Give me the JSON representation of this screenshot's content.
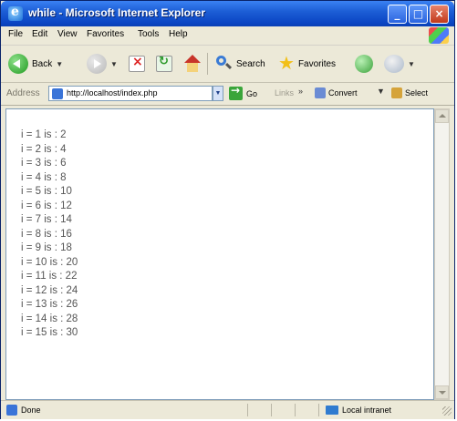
{
  "window": {
    "title": "while - Microsoft Internet Explorer",
    "controls": {
      "minimize": "_",
      "maximize": "□",
      "close": "×"
    }
  },
  "menu": {
    "items": [
      "File",
      "Edit",
      "View",
      "Favorites",
      "Tools",
      "Help"
    ]
  },
  "toolbar": {
    "back_label": "Back",
    "search_label": "Search",
    "favorites_label": "Favorites",
    "icons": [
      "back-icon",
      "forward-icon",
      "stop-icon",
      "refresh-icon",
      "home-icon",
      "search-icon",
      "favorites-icon",
      "media-icon",
      "mail-icon"
    ]
  },
  "address_bar": {
    "label": "Address",
    "url": "http://localhost/index.php",
    "go_label": "Go",
    "links_label": "Links",
    "convert_label": "Convert",
    "select_label": "Select"
  },
  "content": {
    "lines": [
      "i = 1 is : 2",
      "i = 2 is : 4",
      "i = 3 is : 6",
      "i = 4 is : 8",
      "i = 5 is : 10",
      "i = 6 is : 12",
      "i = 7 is : 14",
      "i = 8 is : 16",
      "i = 9 is : 18",
      "i = 10 is : 20",
      "i = 11 is : 22",
      "i = 12 is : 24",
      "i = 13 is : 26",
      "i = 14 is : 28",
      "i = 15 is : 30"
    ]
  },
  "status_bar": {
    "status": "Done",
    "zone": "Local intranet"
  }
}
